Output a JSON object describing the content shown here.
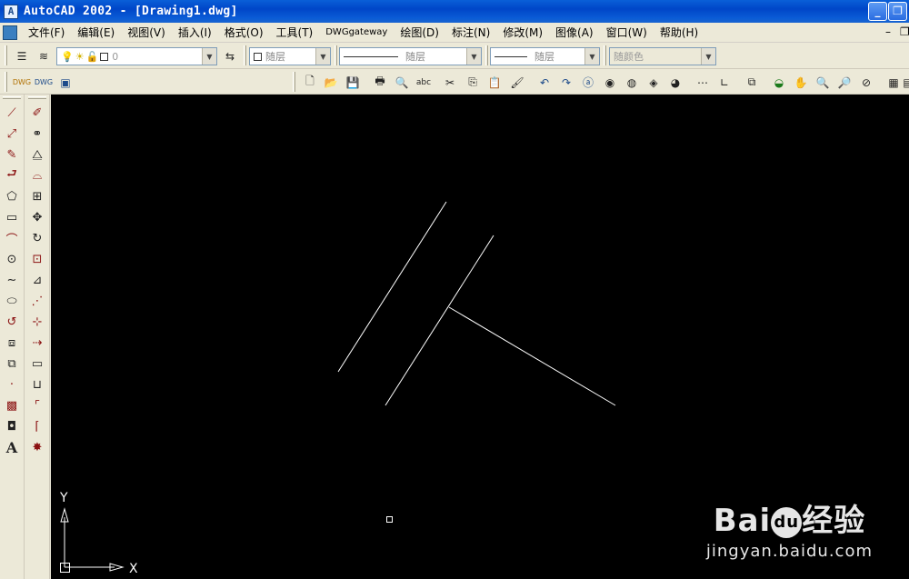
{
  "window": {
    "title": "AutoCAD 2002 - [Drawing1.dwg]",
    "app_icon": "autocad-app-icon",
    "minimize_label": "_",
    "restore_label": "❐"
  },
  "menu": {
    "items": [
      {
        "label": "文件(F)"
      },
      {
        "label": "编辑(E)"
      },
      {
        "label": "视图(V)"
      },
      {
        "label": "插入(I)"
      },
      {
        "label": "格式(O)"
      },
      {
        "label": "工具(T)"
      },
      {
        "label": "DWGgateway"
      },
      {
        "label": "绘图(D)"
      },
      {
        "label": "标注(N)"
      },
      {
        "label": "修改(M)"
      },
      {
        "label": "图像(A)"
      },
      {
        "label": "窗口(W)"
      },
      {
        "label": "帮助(H)"
      }
    ],
    "doc_minimize": "–",
    "doc_restore": "❐"
  },
  "properties_toolbar": {
    "layer_value": "0",
    "color_value": "随层",
    "linetype_value": "随层",
    "lineweight_value": "随层",
    "plotstyle_value": "随颜色"
  },
  "canvas": {
    "background": "#000000",
    "line_color": "#ffffff",
    "ucs_x_label": "X",
    "ucs_y_label": "Y"
  },
  "watermark": {
    "brand": "Bai",
    "brand_suffix": "经验",
    "url": "jingyan.baidu.com"
  }
}
